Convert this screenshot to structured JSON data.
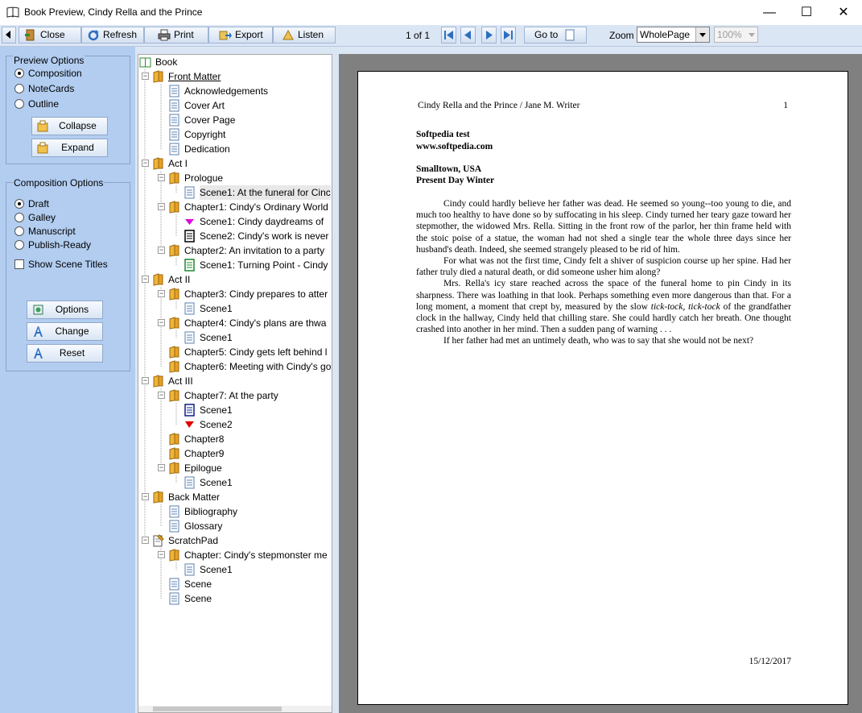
{
  "window": {
    "title": "Book Preview, Cindy Rella and the Prince"
  },
  "toolbar": {
    "close_label": "Close",
    "refresh_label": "Refresh",
    "print_label": "Print",
    "export_label": "Export",
    "listen_label": "Listen",
    "page_indicator": "1 of 1",
    "goto_label": "Go to",
    "zoom_label": "Zoom",
    "zoom_value": "WholePage",
    "zoom_percent": "100%"
  },
  "preview_options": {
    "title": "Preview Options",
    "options": [
      "Composition",
      "NoteCards",
      "Outline"
    ],
    "selected": "Composition",
    "collapse_label": "Collapse",
    "expand_label": "Expand"
  },
  "composition_options": {
    "title": "Composition Options",
    "options": [
      "Draft",
      "Galley",
      "Manuscript",
      "Publish-Ready"
    ],
    "selected": "Draft",
    "show_scene_titles": "Show Scene Titles",
    "options_label": "Options",
    "change_label": "Change",
    "reset_label": "Reset"
  },
  "tree": {
    "root": "Book",
    "front_matter": "Front Matter",
    "fm_items": [
      "Acknowledgements",
      "Cover Art",
      "Cover Page",
      "Copyright",
      "Dedication"
    ],
    "act1": "Act I",
    "prologue": "Prologue",
    "prologue_scene1": "Scene1: At the funeral for Cinc",
    "ch1": "Chapter1: Cindy's Ordinary World",
    "ch1_scene1": "Scene1: Cindy daydreams of",
    "ch1_scene2": "Scene2: Cindy's work is never",
    "ch2": "Chapter2: An invitation to a party",
    "ch2_scene1": "Scene1: Turning Point - Cindy",
    "act2": "Act II",
    "ch3": "Chapter3: Cindy prepares to atter",
    "ch3_scene1": "Scene1",
    "ch4": "Chapter4: Cindy's plans are thwa",
    "ch4_scene1": "Scene1",
    "ch5": "Chapter5: Cindy gets left behind l",
    "ch6": "Chapter6: Meeting with Cindy's go",
    "act3": "Act III",
    "ch7": "Chapter7: At the party",
    "ch7_scene1": "Scene1",
    "ch7_scene2": "Scene2",
    "ch8": "Chapter8",
    "ch9": "Chapter9",
    "epilogue": "Epilogue",
    "epilogue_scene1": "Scene1",
    "back_matter": "Back Matter",
    "bm_items": [
      "Bibliography",
      "Glossary"
    ],
    "scratchpad": "ScratchPad",
    "sp_chapter": "Chapter: Cindy's stepmonster me",
    "sp_chapter_scene1": "Scene1",
    "sp_scenes": [
      "Scene",
      "Scene"
    ]
  },
  "page": {
    "header_left": "Cindy Rella and the Prince / Jane M. Writer",
    "header_page": "1",
    "author_lines": [
      "Softpedia test",
      "www.softpedia.com"
    ],
    "setting_lines": [
      "Smalltown, USA",
      "Present Day Winter"
    ],
    "p1": "Cindy could hardly believe her father was dead. He seemed so young--too young to die, and much too healthy to have done so by suffocating in his sleep. Cindy turned her teary gaze toward her stepmother, the widowed Mrs. Rella. Sitting in the front row of the parlor, her thin frame held with the stoic poise of a statue, the woman had not shed a single tear the whole three days since her husband's death. Indeed, she seemed strangely pleased to be rid of him.",
    "p2": "For what was not the first time, Cindy felt a shiver of suspicion course up her spine. Had her father truly died a natural death, or did someone usher him along?",
    "p3a": "Mrs. Rella's icy stare reached across the space of the funeral home to pin Cindy in its sharpness. There was loathing in that look. Perhaps something even more dangerous than that. For a long moment, a moment that crept by, measured by the slow ",
    "p3i": "tick-tock, tick-tock",
    "p3b": " of the grandfather clock in the hallway, Cindy held that chilling stare. She could hardly catch her breath. One thought crashed into another in her mind. Then a sudden pang of warning . . .",
    "p4": "If her father had met an untimely death, who was to say that she would not be next?",
    "date": "15/12/2017"
  }
}
